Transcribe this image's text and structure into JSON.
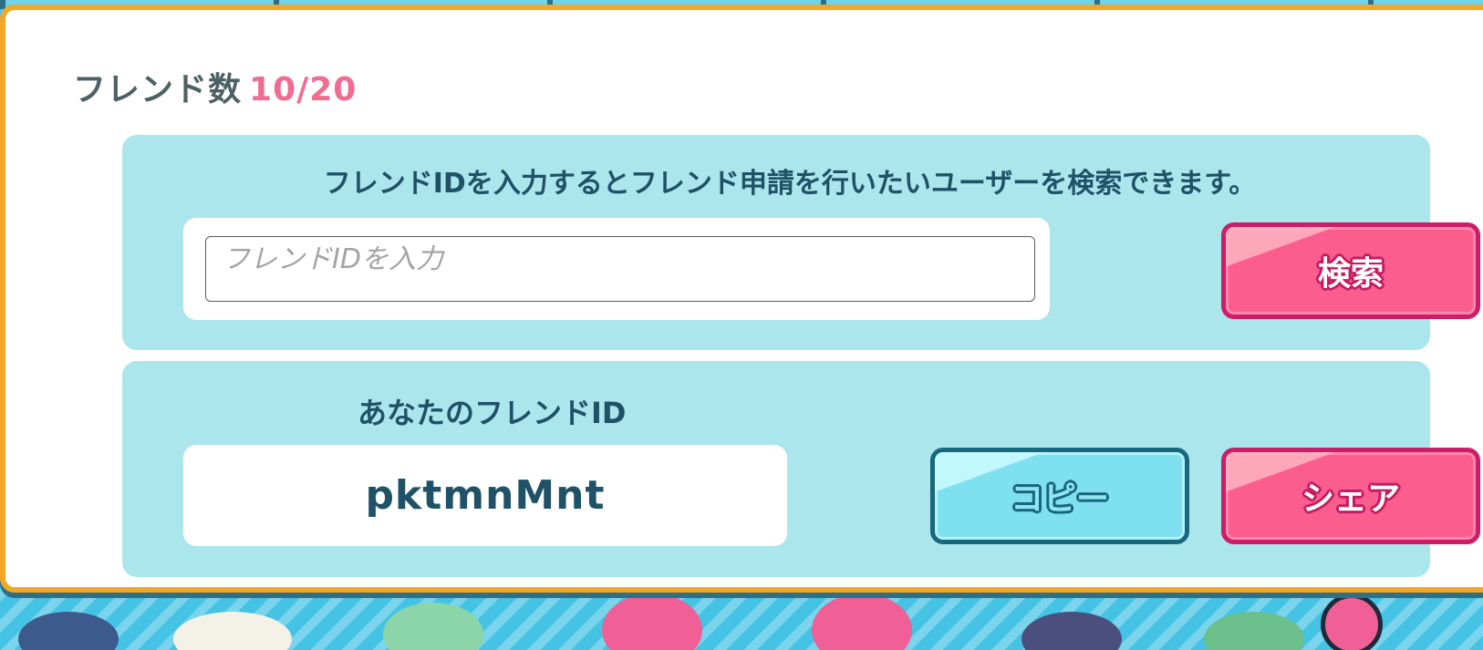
{
  "friends": {
    "label": "フレンド数",
    "count": "10/20"
  },
  "search": {
    "instruction": "フレンドIDを入力するとフレンド申請を行いたいユーザーを検索できます。",
    "placeholder": "フレンドIDを入力",
    "value": "",
    "button_label": "検索"
  },
  "my_id": {
    "label": "あなたのフレンドID",
    "value": "pktmnMnt",
    "copy_label": "コピー",
    "share_label": "シェア"
  },
  "colors": {
    "accent_pink": "#fb5d8f",
    "accent_blue": "#7fe0ef",
    "panel": "#abe6ec",
    "dialog_border": "#f3a727",
    "count_text": "#f26b91"
  }
}
